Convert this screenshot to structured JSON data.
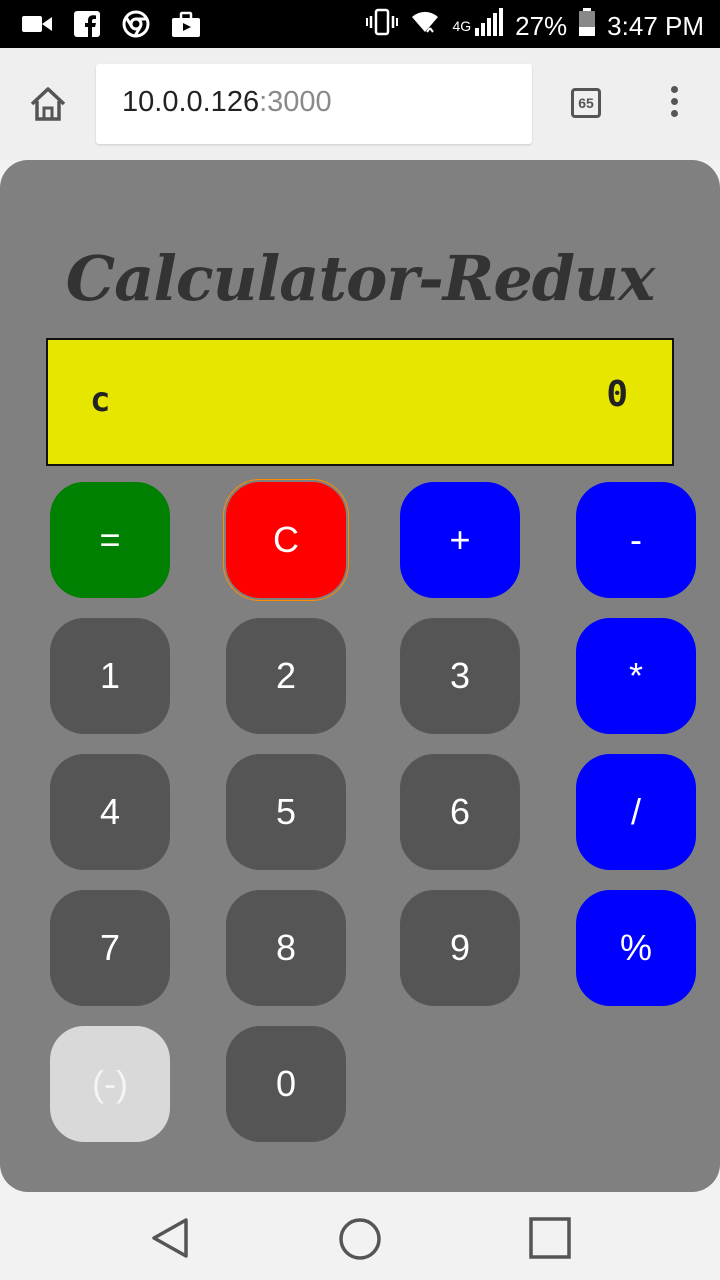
{
  "status_bar": {
    "signal_label": "4G",
    "battery_percent": "27%",
    "time": "3:47 PM",
    "icons": [
      "video-icon",
      "facebook-icon",
      "chrome-icon",
      "briefcase-icon",
      "vibrate-icon",
      "wifi-icon",
      "signal-icon",
      "battery-icon"
    ]
  },
  "browser": {
    "url_host": "10.0.0.126",
    "url_port": ":3000",
    "tab_count": "65",
    "icons": [
      "home-icon",
      "tabs-icon",
      "more-vert-icon"
    ]
  },
  "calculator": {
    "title": "Calculator-Redux",
    "display": {
      "operator": "c",
      "value": "0"
    },
    "buttons": {
      "equals": "=",
      "clear": "C",
      "plus": "+",
      "minus": "-",
      "one": "1",
      "two": "2",
      "three": "3",
      "multiply": "*",
      "four": "4",
      "five": "5",
      "six": "6",
      "divide": "/",
      "seven": "7",
      "eight": "8",
      "nine": "9",
      "percent": "%",
      "negate": "(-)",
      "zero": "0"
    },
    "colors": {
      "panel": "#808080",
      "display": "#e6e600",
      "equals": "#008000",
      "clear": "#ff0000",
      "operator": "#0000ff",
      "digit": "#555555",
      "negate": "#d9d9d9"
    }
  },
  "nav_bar": {
    "icons": [
      "back-icon",
      "home-circle-icon",
      "recents-icon"
    ]
  }
}
